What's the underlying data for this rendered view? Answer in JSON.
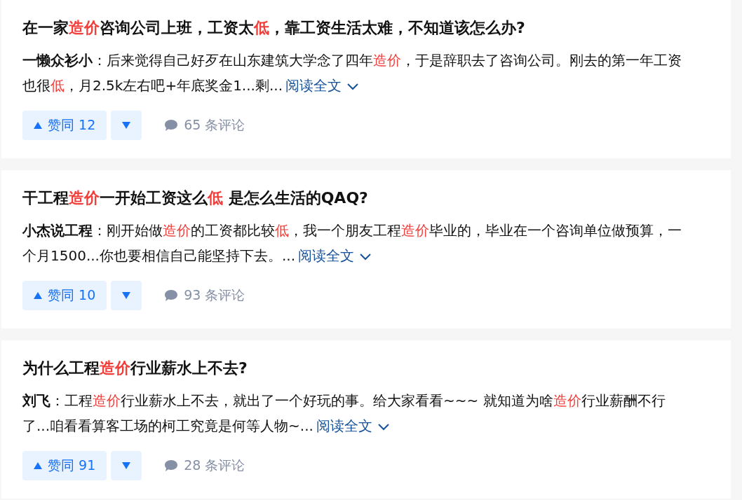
{
  "results": [
    {
      "title": [
        {
          "text": "在一家"
        },
        {
          "text": "造价",
          "highlight": true
        },
        {
          "text": "咨询公司上班，工资太"
        },
        {
          "text": "低",
          "highlight": true
        },
        {
          "text": "，靠工资生活太难，不知道该怎么办?"
        }
      ],
      "author": "一懒众衫小",
      "excerpt": [
        {
          "text": "：后来觉得自己好歹在山东建筑大学念了四年"
        },
        {
          "text": "造价",
          "highlight": true
        },
        {
          "text": "，于是辞职去了咨询公司。刚去的第一年工资也很"
        },
        {
          "text": "低",
          "highlight": true
        },
        {
          "text": "，月2.5k左右吧+年底奖金1...剩..."
        }
      ],
      "read_more": "阅读全文",
      "upvote": "赞同 12",
      "comments": "65 条评论"
    },
    {
      "title": [
        {
          "text": "干工程"
        },
        {
          "text": "造价",
          "highlight": true
        },
        {
          "text": "一开始工资这么"
        },
        {
          "text": "低",
          "highlight": true
        },
        {
          "text": " 是怎么生活的QAQ?"
        }
      ],
      "author": "小杰说工程",
      "excerpt": [
        {
          "text": "：刚开始做"
        },
        {
          "text": "造价",
          "highlight": true
        },
        {
          "text": "的工资都比较"
        },
        {
          "text": "低",
          "highlight": true
        },
        {
          "text": "，我一个朋友工程"
        },
        {
          "text": "造价",
          "highlight": true
        },
        {
          "text": "毕业的，毕业在一个咨询单位做预算，一个月1500...你也要相信自己能坚持下去。..."
        }
      ],
      "read_more": "阅读全文",
      "upvote": "赞同 10",
      "comments": "93 条评论"
    },
    {
      "title": [
        {
          "text": "为什么工程"
        },
        {
          "text": "造价",
          "highlight": true
        },
        {
          "text": "行业薪水上不去?"
        }
      ],
      "author": "刘飞",
      "excerpt": [
        {
          "text": "：工程"
        },
        {
          "text": "造价",
          "highlight": true
        },
        {
          "text": "行业薪水上不去，就出了一个好玩的事。给大家看看~~~ 就知道为啥"
        },
        {
          "text": "造价",
          "highlight": true
        },
        {
          "text": "行业薪酬不行了...咱看看算客工场的柯工究竟是何等人物~..."
        }
      ],
      "read_more": "阅读全文",
      "upvote": "赞同 91",
      "comments": "28 条评论"
    }
  ]
}
